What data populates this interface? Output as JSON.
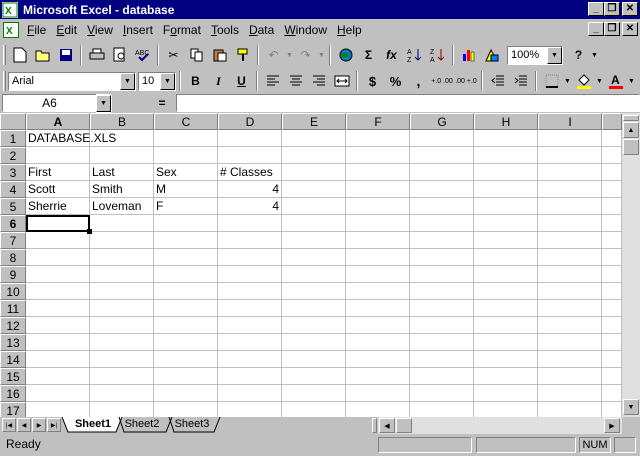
{
  "window": {
    "title": "Microsoft Excel - database"
  },
  "menu": [
    {
      "label": "File",
      "key": "F"
    },
    {
      "label": "Edit",
      "key": "E"
    },
    {
      "label": "View",
      "key": "V"
    },
    {
      "label": "Insert",
      "key": "I"
    },
    {
      "label": "Format",
      "key": "o"
    },
    {
      "label": "Tools",
      "key": "T"
    },
    {
      "label": "Data",
      "key": "D"
    },
    {
      "label": "Window",
      "key": "W"
    },
    {
      "label": "Help",
      "key": "H"
    }
  ],
  "toolbar": {
    "zoom": "100%",
    "icons": [
      "new-icon",
      "open-icon",
      "save-icon",
      "print-icon",
      "print-preview-icon",
      "spelling-icon",
      "cut-icon",
      "copy-icon",
      "paste-icon",
      "format-painter-icon",
      "undo-icon",
      "redo-icon",
      "web-icon",
      "autosum-icon",
      "function-icon",
      "sort-ascending-icon",
      "sort-descending-icon",
      "chart-wizard-icon",
      "drawing-icon",
      "help-icon"
    ]
  },
  "format_toolbar": {
    "font": "Arial",
    "size": "10",
    "bold": "B",
    "italic": "I",
    "underline": "U",
    "currency": "$",
    "percent": "%",
    "comma": ",",
    "inc_decimal": "+.0 .00",
    "dec_decimal": ".00 +.0"
  },
  "formula_bar": {
    "name_box": "A6",
    "equals": "=",
    "content": ""
  },
  "columns": [
    "A",
    "B",
    "C",
    "D",
    "E",
    "F",
    "G",
    "H",
    "I"
  ],
  "rows": [
    "1",
    "2",
    "3",
    "4",
    "5",
    "6",
    "7",
    "8",
    "9",
    "10",
    "11",
    "12",
    "13",
    "14",
    "15",
    "16",
    "17"
  ],
  "cells": [
    {
      "ref": "A1",
      "value": "DATABASE.XLS"
    },
    {
      "ref": "A3",
      "value": "First"
    },
    {
      "ref": "B3",
      "value": "Last"
    },
    {
      "ref": "C3",
      "value": "Sex"
    },
    {
      "ref": "D3",
      "value": "# Classes"
    },
    {
      "ref": "A4",
      "value": "Scott"
    },
    {
      "ref": "B4",
      "value": "Smith"
    },
    {
      "ref": "C4",
      "value": "M"
    },
    {
      "ref": "D4",
      "value": "4",
      "numeric": true
    },
    {
      "ref": "A5",
      "value": "Sherrie"
    },
    {
      "ref": "B5",
      "value": "Loveman"
    },
    {
      "ref": "C5",
      "value": "F"
    },
    {
      "ref": "D5",
      "value": "4",
      "numeric": true
    }
  ],
  "active_cell": "A6",
  "sheets": [
    {
      "name": "Sheet1",
      "active": true
    },
    {
      "name": "Sheet2",
      "active": false
    },
    {
      "name": "Sheet3",
      "active": false
    }
  ],
  "status": {
    "text": "Ready",
    "num": "NUM"
  },
  "colors": {
    "title_bar": "#000080",
    "face": "#c0c0c0",
    "grid": "#c0c0c0",
    "font_color_bar": "#ff0000",
    "fill_color_bar": "#ffff00"
  }
}
